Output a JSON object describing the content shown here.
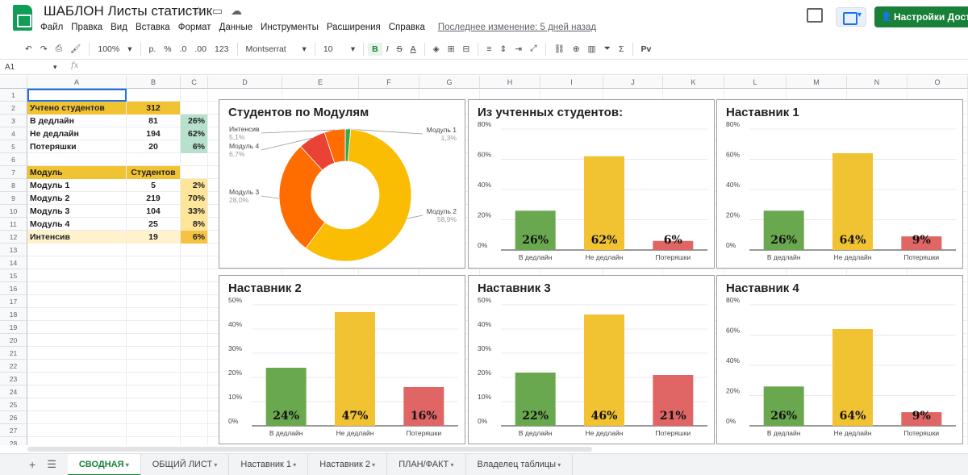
{
  "titlebar": {
    "title": "ШАБЛОН Листы статистик",
    "share_label": "Настройки Доступа"
  },
  "menu": [
    "Файл",
    "Правка",
    "Вид",
    "Вставка",
    "Формат",
    "Данные",
    "Инструменты",
    "Расширения",
    "Справка"
  ],
  "last_edit": "Последнее изменение: 5 дней назад",
  "toolbar": {
    "zoom": "100%",
    "currency": "р.",
    "percent": "%",
    "dec_less": ".0",
    "dec_more": ".00",
    "format_more": "123",
    "font": "Montserrat",
    "font_size": "10",
    "bold": "B",
    "italic": "I",
    "strike": "S",
    "text_color": "A",
    "sigma": "Σ",
    "script_label": "Рv"
  },
  "formula": {
    "cell_ref": "A1",
    "fx": "fx"
  },
  "columns": [
    "A",
    "B",
    "C",
    "D",
    "E",
    "F",
    "G",
    "H",
    "I",
    "J",
    "K",
    "L",
    "M",
    "N",
    "O"
  ],
  "rows": [
    "1",
    "2",
    "3",
    "4",
    "5",
    "6",
    "7",
    "8",
    "9",
    "10",
    "11",
    "12",
    "13",
    "14",
    "15",
    "16",
    "17",
    "18",
    "19",
    "20",
    "21",
    "22",
    "23",
    "24",
    "25",
    "26",
    "27",
    "28"
  ],
  "table1": {
    "header": {
      "label": "Учтено студентов",
      "value": "312"
    },
    "rows": [
      {
        "label": "В дедлайн",
        "value": "81",
        "pct": "26%"
      },
      {
        "label": "Не дедлайн",
        "value": "194",
        "pct": "62%"
      },
      {
        "label": "Потеряшки",
        "value": "20",
        "pct": "6%"
      }
    ]
  },
  "table2": {
    "header": {
      "label": "Модуль",
      "value": "Студентов"
    },
    "rows": [
      {
        "label": "Модуль 1",
        "value": "5",
        "pct": "2%"
      },
      {
        "label": "Модуль 2",
        "value": "219",
        "pct": "70%"
      },
      {
        "label": "Модуль 3",
        "value": "104",
        "pct": "33%"
      },
      {
        "label": "Модуль 4",
        "value": "25",
        "pct": "8%"
      },
      {
        "label": "Интенсив",
        "value": "19",
        "pct": "6%"
      }
    ]
  },
  "colors": {
    "green": "#6aa84f",
    "yellow": "#f1c232",
    "red": "#e06666",
    "header_orange": "#f1c232",
    "pct_green": "#b7e1cd",
    "pct_yellow": "#ffe599"
  },
  "chart_data": [
    {
      "type": "pie",
      "title": "Студентов по Модулям",
      "donut": true,
      "labels": [
        "Модуль 1",
        "Модуль 2",
        "Модуль 3",
        "Модуль 4",
        "Интенсив"
      ],
      "values": [
        1.3,
        58.9,
        28.0,
        6.7,
        5.1
      ],
      "value_labels": [
        "1,3%",
        "58,9%",
        "28,0%",
        "6,7%",
        "5,1%"
      ],
      "colors": [
        "#34a853",
        "#fbbc04",
        "#ff6d01",
        "#ea4335",
        "#ff6d01"
      ]
    },
    {
      "type": "bar",
      "title": "Из учтенных студентов:",
      "categories": [
        "В дедлайн",
        "Не дедлайн",
        "Потеряшки"
      ],
      "values": [
        26,
        62,
        6
      ],
      "data_labels": [
        "26%",
        "62%",
        "6%"
      ],
      "ylim": [
        0,
        80
      ],
      "yticks": [
        "0%",
        "20%",
        "40%",
        "60%",
        "80%"
      ],
      "ytick_values": [
        0,
        20,
        40,
        60,
        80
      ]
    },
    {
      "type": "bar",
      "title": "Наставник 1",
      "categories": [
        "В дедлайн",
        "Не дедлайн",
        "Потеряшки"
      ],
      "values": [
        26,
        64,
        9
      ],
      "data_labels": [
        "26%",
        "64%",
        "9%"
      ],
      "ylim": [
        0,
        80
      ],
      "yticks": [
        "0%",
        "20%",
        "40%",
        "60%",
        "80%"
      ],
      "ytick_values": [
        0,
        20,
        40,
        60,
        80
      ]
    },
    {
      "type": "bar",
      "title": "Наставник 2",
      "categories": [
        "В дедлайн",
        "Не дедлайн",
        "Потеряшки"
      ],
      "values": [
        24,
        47,
        16
      ],
      "data_labels": [
        "24%",
        "47%",
        "16%"
      ],
      "ylim": [
        0,
        50
      ],
      "yticks": [
        "0%",
        "10%",
        "20%",
        "30%",
        "40%",
        "50%"
      ],
      "ytick_values": [
        0,
        10,
        20,
        30,
        40,
        50
      ]
    },
    {
      "type": "bar",
      "title": "Наставник 3",
      "categories": [
        "В дедлайн",
        "Не дедлайн",
        "Потеряшки"
      ],
      "values": [
        22,
        46,
        21
      ],
      "data_labels": [
        "22%",
        "46%",
        "21%"
      ],
      "ylim": [
        0,
        50
      ],
      "yticks": [
        "0%",
        "10%",
        "20%",
        "30%",
        "40%",
        "50%"
      ],
      "ytick_values": [
        0,
        10,
        20,
        30,
        40,
        50
      ]
    },
    {
      "type": "bar",
      "title": "Наставник 4",
      "categories": [
        "В дедлайн",
        "Не дедлайн",
        "Потеряшки"
      ],
      "values": [
        26,
        64,
        9
      ],
      "data_labels": [
        "26%",
        "64%",
        "9%"
      ],
      "ylim": [
        0,
        80
      ],
      "yticks": [
        "0%",
        "20%",
        "40%",
        "60%",
        "80%"
      ],
      "ytick_values": [
        0,
        20,
        40,
        60,
        80
      ]
    }
  ],
  "tabs": [
    {
      "label": "СВОДНАЯ",
      "active": true
    },
    {
      "label": "ОБЩИЙ ЛИСТ",
      "active": false
    },
    {
      "label": "Наставник 1",
      "active": false
    },
    {
      "label": "Наставник 2",
      "active": false
    },
    {
      "label": "ПЛАН/ФАКТ",
      "active": false
    },
    {
      "label": "Владелец таблицы",
      "active": false
    }
  ]
}
